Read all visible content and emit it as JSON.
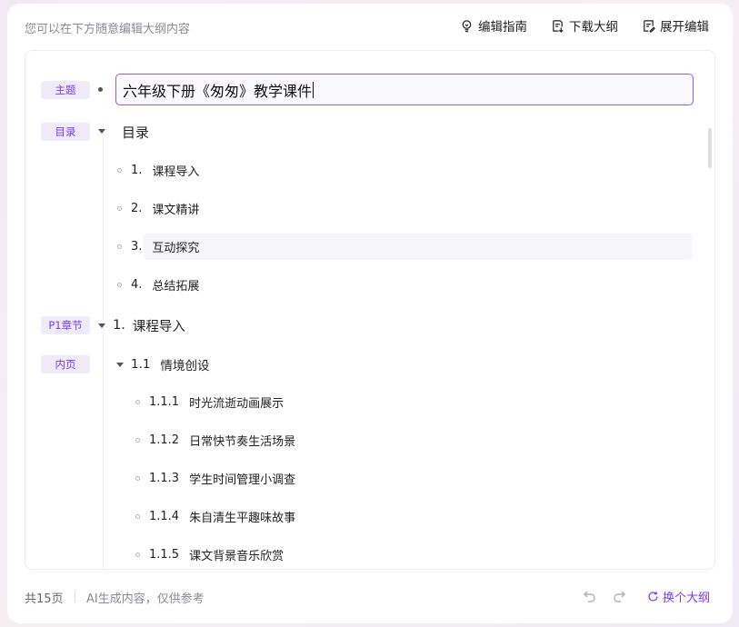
{
  "header": {
    "hint": "您可以在下方随意编辑大纲内容",
    "actions": [
      {
        "label": "编辑指南",
        "icon": "lightbulb-icon"
      },
      {
        "label": "下载大纲",
        "icon": "download-doc-icon"
      },
      {
        "label": "展开编辑",
        "icon": "edit-doc-icon"
      }
    ]
  },
  "outline": {
    "tags": {
      "topic": "主题",
      "toc": "目录",
      "chapter": "P1章节",
      "inner": "内页"
    },
    "title": "六年级下册《匆匆》教学课件",
    "toc_heading": "目录",
    "toc_items": [
      {
        "num": "1.",
        "text": "课程导入"
      },
      {
        "num": "2.",
        "text": "课文精讲"
      },
      {
        "num": "3.",
        "text": "互动探究"
      },
      {
        "num": "4.",
        "text": "总结拓展"
      }
    ],
    "chapter": {
      "num": "1.",
      "text": "课程导入"
    },
    "section": {
      "num": "1.1",
      "text": "情境创设"
    },
    "subitems": [
      {
        "num": "1.1.1",
        "text": "时光流逝动画展示"
      },
      {
        "num": "1.1.2",
        "text": "日常快节奏生活场景"
      },
      {
        "num": "1.1.3",
        "text": "学生时间管理小调查"
      },
      {
        "num": "1.1.4",
        "text": "朱自清生平趣味故事"
      },
      {
        "num": "1.1.5",
        "text": "课文背景音乐欣赏"
      }
    ]
  },
  "footer": {
    "count": "共15页",
    "disclaimer": "AI生成内容，仅供参考",
    "regen_label": "换个大纲"
  },
  "colors": {
    "accent": "#7c3aed",
    "tag_bg": "#f0ebfa"
  }
}
